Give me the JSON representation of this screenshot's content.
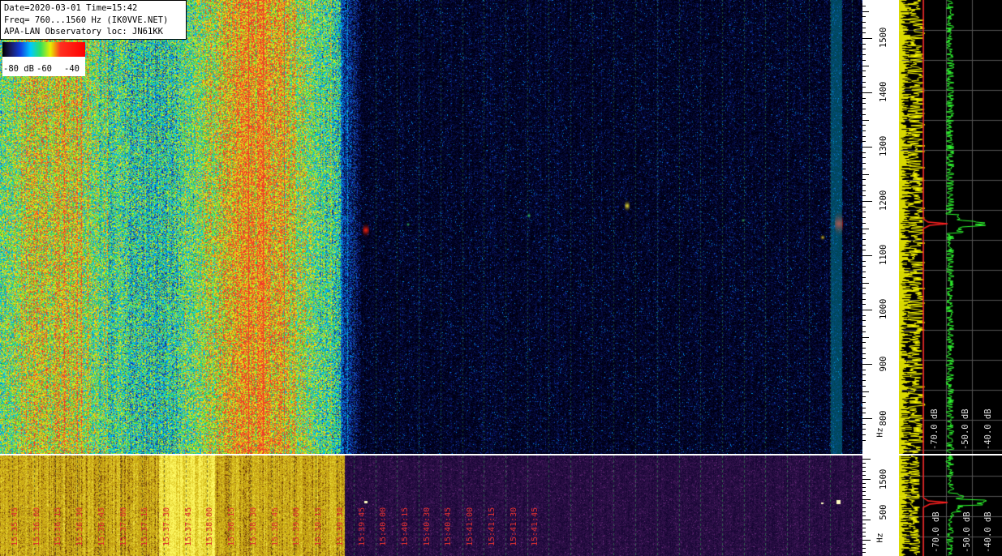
{
  "info": {
    "line1": "Date=2020-03-01 Time=15:42",
    "line2": "Freq= 760...1560 Hz (IK0VVE.NET)",
    "line3": "APA-LAN Observatory loc: JN61KK"
  },
  "colorbar": {
    "labels": [
      "-80 dB",
      "-60",
      "-40"
    ]
  },
  "frequency_scale_top": {
    "labels": [
      "1500",
      "1400",
      "1300",
      "1200",
      "1100",
      "1000",
      "900",
      "800"
    ],
    "unit": "Hz"
  },
  "frequency_scale_bottom": {
    "labels": [
      "1500",
      "500"
    ],
    "unit": "Hz"
  },
  "spectrum_top": {
    "db_labels": [
      "-70.0 dB",
      "-50.0 dB",
      "-40.0 dB"
    ]
  },
  "spectrum_bottom": {
    "db_labels": [
      "-70.0 dB",
      "-50.0 dB",
      "-40.0 dB"
    ]
  },
  "time_labels": [
    "15:35:45",
    "15:36:00",
    "15:36:15",
    "15:36:30",
    "15:36:45",
    "15:37:00",
    "15:37:15",
    "15:37:30",
    "15:37:45",
    "15:38:00",
    "15:38:15",
    "15:38:30",
    "15:38:45",
    "15:39:00",
    "15:39:15",
    "15:39:30",
    "15:39:45",
    "15:40:00",
    "15:40:15",
    "15:40:30",
    "15:40:45",
    "15:41:00",
    "15:41:15",
    "15:41:30",
    "15:41:45"
  ],
  "colors": {
    "time_label": "#e03030",
    "spectrum_current": "#ffff00",
    "spectrum_average": "#30ff30",
    "spectrum_peak": "#ff2020"
  }
}
